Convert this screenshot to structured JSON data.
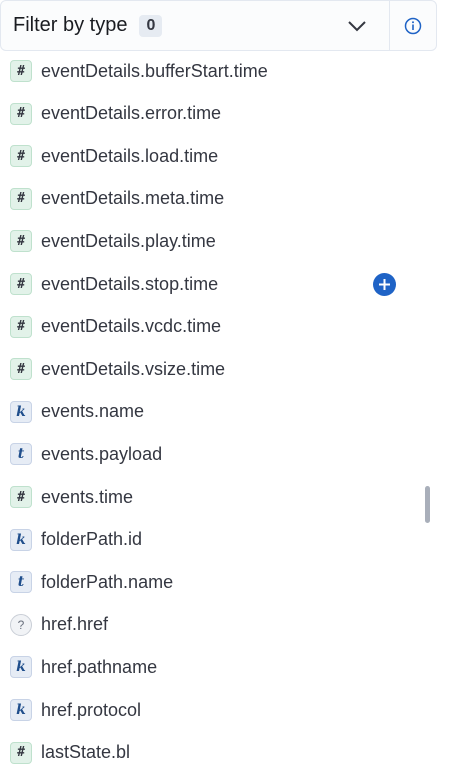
{
  "header": {
    "filter_label": "Filter by type",
    "count": "0",
    "chevron_icon": "chevron-down-icon",
    "info_icon": "info-icon"
  },
  "fields": [
    {
      "type": "number",
      "token": "#",
      "name": "eventDetails.bufferStart.time"
    },
    {
      "type": "number",
      "token": "#",
      "name": "eventDetails.error.time"
    },
    {
      "type": "number",
      "token": "#",
      "name": "eventDetails.load.time"
    },
    {
      "type": "number",
      "token": "#",
      "name": "eventDetails.meta.time"
    },
    {
      "type": "number",
      "token": "#",
      "name": "eventDetails.play.time"
    },
    {
      "type": "number",
      "token": "#",
      "name": "eventDetails.stop.time"
    },
    {
      "type": "number",
      "token": "#",
      "name": "eventDetails.vcdc.time"
    },
    {
      "type": "number",
      "token": "#",
      "name": "eventDetails.vsize.time"
    },
    {
      "type": "keyword",
      "token": "k",
      "name": "events.name"
    },
    {
      "type": "text",
      "token": "t",
      "name": "events.payload"
    },
    {
      "type": "number",
      "token": "#",
      "name": "events.time"
    },
    {
      "type": "keyword",
      "token": "k",
      "name": "folderPath.id"
    },
    {
      "type": "text",
      "token": "t",
      "name": "folderPath.name"
    },
    {
      "type": "unknown",
      "token": "?",
      "name": "href.href"
    },
    {
      "type": "keyword",
      "token": "k",
      "name": "href.pathname"
    },
    {
      "type": "keyword",
      "token": "k",
      "name": "href.protocol"
    },
    {
      "type": "number",
      "token": "#",
      "name": "lastState.bl"
    }
  ],
  "colors": {
    "accent": "#1f63c6",
    "number_token_bg": "#e2f2e9",
    "keyword_token_bg": "#e6ecf5"
  }
}
